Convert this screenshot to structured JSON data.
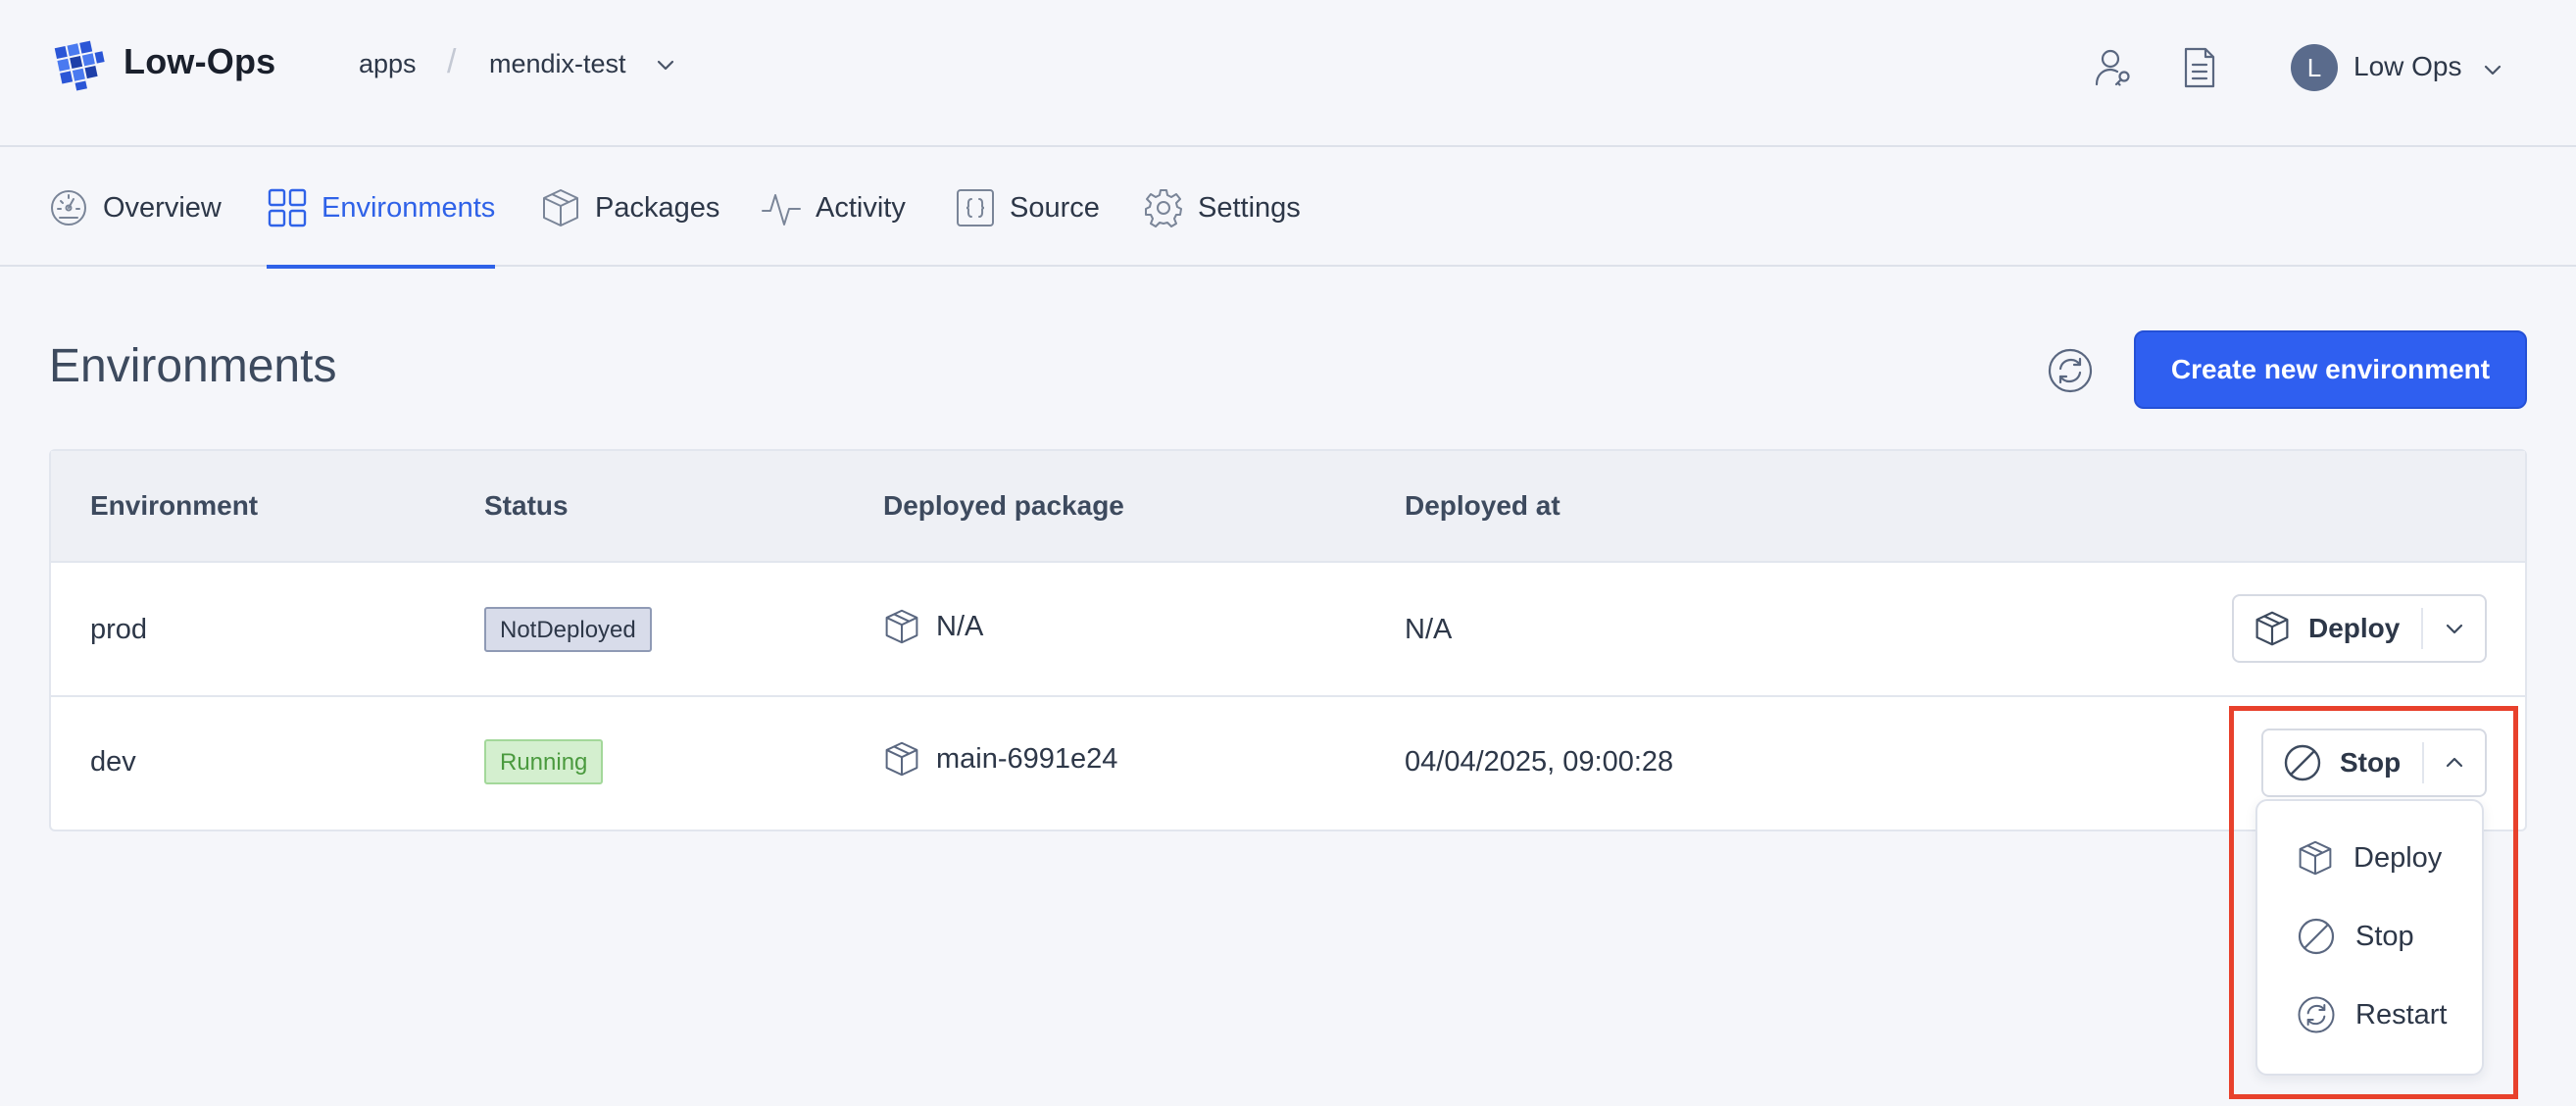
{
  "header": {
    "brand": "Low-Ops",
    "breadcrumb": {
      "root": "apps",
      "separator": "/",
      "app": "mendix-test"
    },
    "user": {
      "initial": "L",
      "name": "Low Ops"
    },
    "icons": [
      "user-key-icon",
      "document-icon",
      "chevron-down-icon"
    ]
  },
  "tabs": [
    {
      "label": "Overview",
      "icon": "dashboard-icon"
    },
    {
      "label": "Environments",
      "icon": "grid-icon",
      "active": true
    },
    {
      "label": "Packages",
      "icon": "package-icon"
    },
    {
      "label": "Activity",
      "icon": "activity-icon"
    },
    {
      "label": "Source",
      "icon": "code-braces-icon"
    },
    {
      "label": "Settings",
      "icon": "gear-icon"
    }
  ],
  "page": {
    "title": "Environments",
    "create_label": "Create new environment"
  },
  "table": {
    "columns": [
      "Environment",
      "Status",
      "Deployed package",
      "Deployed at"
    ],
    "rows": [
      {
        "environment": "prod",
        "status": "NotDeployed",
        "package": "N/A",
        "deployed_at": "N/A",
        "action": "Deploy"
      },
      {
        "environment": "dev",
        "status": "Running",
        "package": "main-6991e24",
        "deployed_at": "04/04/2025, 09:00:28",
        "action": "Stop"
      }
    ]
  },
  "dropdown": {
    "items": [
      {
        "label": "Deploy",
        "icon": "package-icon"
      },
      {
        "label": "Stop",
        "icon": "stop-icon"
      },
      {
        "label": "Restart",
        "icon": "refresh-icon"
      }
    ]
  },
  "colors": {
    "accent": "#2f5ff0",
    "running_bg": "#d4efcf",
    "not_deployed_bg": "#d8dcea",
    "highlight": "#e8412c"
  }
}
